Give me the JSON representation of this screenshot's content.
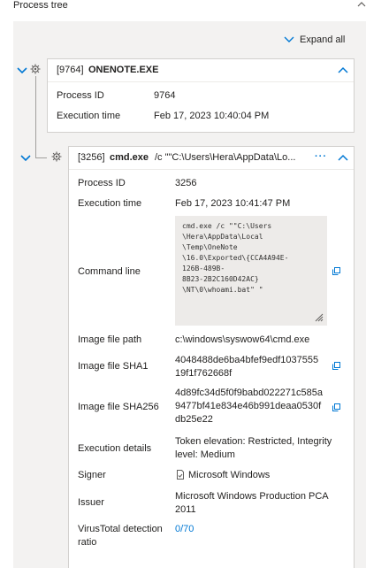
{
  "header": {
    "title": "Process tree"
  },
  "toolbar": {
    "expand_all_label": "Expand all"
  },
  "process1": {
    "pid_tag": "[9764]",
    "name": "ONENOTE.EXE",
    "fields": {
      "pid_label": "Process ID",
      "pid_value": "9764",
      "time_label": "Execution time",
      "time_value": "Feb 17, 2023 10:40:04 PM"
    }
  },
  "process2": {
    "pid_tag": "[3256]",
    "name": "cmd.exe",
    "args": "/c \"\"C:\\Users\\Hera\\AppData\\Lo...",
    "more_label": "···",
    "fields": {
      "pid_label": "Process ID",
      "pid_value": "3256",
      "time_label": "Execution time",
      "time_value": "Feb 17, 2023 10:41:47 PM",
      "cmd_label": "Command line",
      "cmd_value": "cmd.exe /c \"\"C:\\Users\n\\Hera\\AppData\\Local\n\\Temp\\OneNote\n\\16.0\\Exported\\{CCA4A94E-\n126B-489B-\n8B23-2B2C160D42AC}\n\\NT\\0\\whoami.bat\" \"",
      "path_label": "Image file path",
      "path_value": "c:\\windows\\syswow64\\cmd.exe",
      "sha1_label": "Image file SHA1",
      "sha1_line1": "4048488de6ba4bfef9edf1037555",
      "sha1_line2": "19f1f762668f",
      "sha256_label": "Image file SHA256",
      "sha256_line1": "4d89fc34d5f0f9babd022271c585a",
      "sha256_line2": "9477bf41e834e46b991deaa0530f",
      "sha256_line3": "db25e22",
      "exec_label": "Execution details",
      "exec_line1": "Token elevation: Restricted, Integrity",
      "exec_line2": "level: Medium",
      "signer_label": "Signer",
      "signer_value": "Microsoft Windows",
      "issuer_label": "Issuer",
      "issuer_line1": "Microsoft Windows Production PCA",
      "issuer_line2": "2011",
      "vt_label_line1": "VirusTotal detection",
      "vt_label_line2": "ratio",
      "vt_value": "0/70"
    }
  },
  "colors": {
    "accent": "#0078d4",
    "panel": "#f3f2f1",
    "card": "#ffffff",
    "text": "#201f1e"
  }
}
